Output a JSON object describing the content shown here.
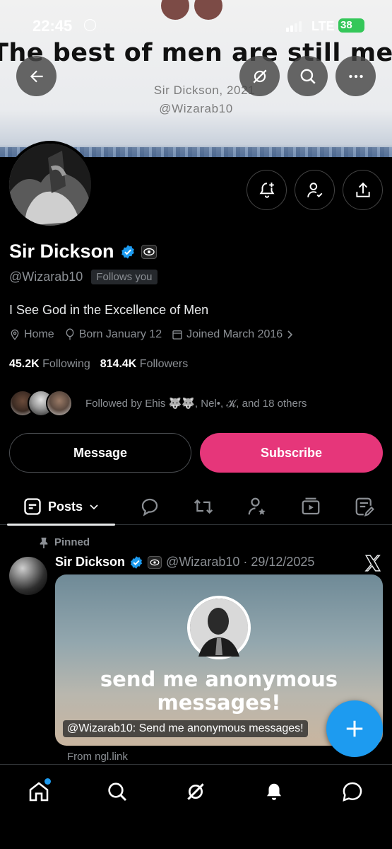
{
  "status_bar": {
    "time": "22:45",
    "network": "LTE",
    "battery": "38"
  },
  "banner": {
    "quote": "The best of men are still men",
    "signature": "Sir Dickson, 2021",
    "signature_handle": "@Wizarab10"
  },
  "profile": {
    "name": "Sir Dickson",
    "handle": "@Wizarab10",
    "follows_you": "Follows you",
    "bio": "I See God in the Excellence of Men",
    "location": "Home",
    "born": "Born January 12",
    "joined": "Joined March 2016",
    "following_count": "45.2K",
    "following_label": "Following",
    "followers_count": "814.4K",
    "followers_label": "Followers",
    "followed_by": "Followed by Ehis 🐺🐺, Nel•, 𝓚, and 18 others"
  },
  "actions": {
    "message": "Message",
    "subscribe": "Subscribe"
  },
  "tabs": {
    "posts": "Posts"
  },
  "post": {
    "pinned_label": "Pinned",
    "author": "Sir Dickson",
    "handle_date": "@Wizarab10 · 29/12/2025",
    "card_headline": "send me anonymous messages!",
    "card_caption": "@Wizarab10: Send me anonymous messages!",
    "source": "From ngl.link"
  },
  "colors": {
    "accent": "#1d9bf0",
    "subscribe": "#e6367a",
    "background": "#000000"
  }
}
